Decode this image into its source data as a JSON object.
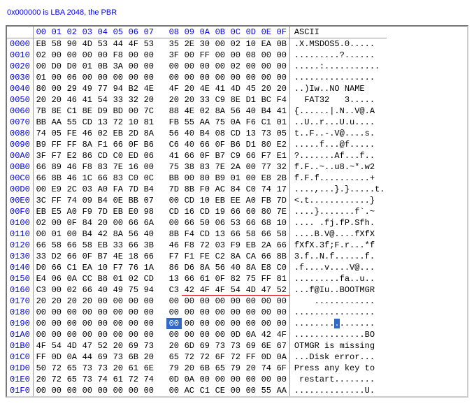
{
  "note": "0x000000 is LBA 2048, the PBR",
  "headers": {
    "offset": "",
    "cols": [
      "00",
      "01",
      "02",
      "03",
      "04",
      "05",
      "06",
      "07",
      "08",
      "09",
      "0A",
      "0B",
      "0C",
      "0D",
      "0E",
      "0F"
    ],
    "ascii": "ASCII"
  },
  "highlight": {
    "row": 25,
    "col": 8
  },
  "underline": {
    "row": 22,
    "start": 9,
    "end": 15
  },
  "rows": [
    {
      "off": "0000",
      "hex": [
        "EB",
        "58",
        "90",
        "4D",
        "53",
        "44",
        "4F",
        "53",
        "35",
        "2E",
        "30",
        "00",
        "02",
        "10",
        "EA",
        "0B"
      ],
      "asc": ".X.MSDOS5.0....."
    },
    {
      "off": "0010",
      "hex": [
        "02",
        "00",
        "00",
        "00",
        "00",
        "F8",
        "00",
        "00",
        "3F",
        "00",
        "FF",
        "00",
        "00",
        "08",
        "00",
        "00"
      ],
      "asc": ".........?......"
    },
    {
      "off": "0020",
      "hex": [
        "00",
        "D0",
        "D0",
        "01",
        "0B",
        "3A",
        "00",
        "00",
        "00",
        "00",
        "00",
        "00",
        "02",
        "00",
        "00",
        "00"
      ],
      "asc": ".....:..........."
    },
    {
      "off": "0030",
      "hex": [
        "01",
        "00",
        "06",
        "00",
        "00",
        "00",
        "00",
        "00",
        "00",
        "00",
        "00",
        "00",
        "00",
        "00",
        "00",
        "00"
      ],
      "asc": "................"
    },
    {
      "off": "0040",
      "hex": [
        "80",
        "00",
        "29",
        "49",
        "77",
        "94",
        "B2",
        "4E",
        "4F",
        "20",
        "4E",
        "41",
        "4D",
        "45",
        "20",
        "20"
      ],
      "asc": "..)Iw..NO NAME  "
    },
    {
      "off": "0050",
      "hex": [
        "20",
        "20",
        "46",
        "41",
        "54",
        "33",
        "32",
        "20",
        "20",
        "20",
        "33",
        "C9",
        "8E",
        "D1",
        "BC",
        "F4"
      ],
      "asc": "  FAT32   3....."
    },
    {
      "off": "0060",
      "hex": [
        "7B",
        "8E",
        "C1",
        "8E",
        "D9",
        "BD",
        "00",
        "7C",
        "88",
        "4E",
        "02",
        "8A",
        "56",
        "40",
        "B4",
        "41"
      ],
      "asc": "{......|.N..V@.A"
    },
    {
      "off": "0070",
      "hex": [
        "BB",
        "AA",
        "55",
        "CD",
        "13",
        "72",
        "10",
        "81",
        "FB",
        "55",
        "AA",
        "75",
        "0A",
        "F6",
        "C1",
        "01"
      ],
      "asc": "..U..r...U.u...."
    },
    {
      "off": "0080",
      "hex": [
        "74",
        "05",
        "FE",
        "46",
        "02",
        "EB",
        "2D",
        "8A",
        "56",
        "40",
        "B4",
        "08",
        "CD",
        "13",
        "73",
        "05"
      ],
      "asc": "t..F..-.V@....s."
    },
    {
      "off": "0090",
      "hex": [
        "B9",
        "FF",
        "FF",
        "8A",
        "F1",
        "66",
        "0F",
        "B6",
        "C6",
        "40",
        "66",
        "0F",
        "B6",
        "D1",
        "80",
        "E2"
      ],
      "asc": ".....f...@f....."
    },
    {
      "off": "00A0",
      "hex": [
        "3F",
        "F7",
        "E2",
        "86",
        "CD",
        "C0",
        "ED",
        "06",
        "41",
        "66",
        "0F",
        "B7",
        "C9",
        "66",
        "F7",
        "E1"
      ],
      "asc": "?.......Af...f.."
    },
    {
      "off": "00B0",
      "hex": [
        "66",
        "89",
        "46",
        "F8",
        "83",
        "7E",
        "16",
        "00",
        "75",
        "38",
        "83",
        "7E",
        "2A",
        "00",
        "77",
        "32"
      ],
      "asc": "f.F..~..u8.~*.w2"
    },
    {
      "off": "00C0",
      "hex": [
        "66",
        "8B",
        "46",
        "1C",
        "66",
        "83",
        "C0",
        "0C",
        "BB",
        "00",
        "80",
        "B9",
        "01",
        "00",
        "E8",
        "2B"
      ],
      "asc": "f.F.f..........+"
    },
    {
      "off": "00D0",
      "hex": [
        "00",
        "E9",
        "2C",
        "03",
        "A0",
        "FA",
        "7D",
        "B4",
        "7D",
        "8B",
        "F0",
        "AC",
        "84",
        "C0",
        "74",
        "17"
      ],
      "asc": "....,...}.}.....t."
    },
    {
      "off": "00E0",
      "hex": [
        "3C",
        "FF",
        "74",
        "09",
        "B4",
        "0E",
        "BB",
        "07",
        "00",
        "CD",
        "10",
        "EB",
        "EE",
        "A0",
        "FB",
        "7D"
      ],
      "asc": "<.t............}"
    },
    {
      "off": "00F0",
      "hex": [
        "EB",
        "E5",
        "A0",
        "F9",
        "7D",
        "EB",
        "E0",
        "98",
        "CD",
        "16",
        "CD",
        "19",
        "66",
        "60",
        "80",
        "7E"
      ],
      "asc": "....}.......f`.~"
    },
    {
      "off": "0100",
      "hex": [
        "02",
        "00",
        "0F",
        "84",
        "20",
        "00",
        "66",
        "6A",
        "00",
        "66",
        "50",
        "06",
        "53",
        "66",
        "68",
        "10"
      ],
      "asc": ".... .fj.fP.Sfh."
    },
    {
      "off": "0110",
      "hex": [
        "00",
        "01",
        "00",
        "B4",
        "42",
        "8A",
        "56",
        "40",
        "8B",
        "F4",
        "CD",
        "13",
        "66",
        "58",
        "66",
        "58"
      ],
      "asc": "....B.V@....fXfX"
    },
    {
      "off": "0120",
      "hex": [
        "66",
        "58",
        "66",
        "58",
        "EB",
        "33",
        "66",
        "3B",
        "46",
        "F8",
        "72",
        "03",
        "F9",
        "EB",
        "2A",
        "66"
      ],
      "asc": "fXfX.3f;F.r...*f"
    },
    {
      "off": "0130",
      "hex": [
        "33",
        "D2",
        "66",
        "0F",
        "B7",
        "4E",
        "18",
        "66",
        "F7",
        "F1",
        "FE",
        "C2",
        "8A",
        "CA",
        "66",
        "8B"
      ],
      "asc": "3.f..N.f......f."
    },
    {
      "off": "0140",
      "hex": [
        "D0",
        "66",
        "C1",
        "EA",
        "10",
        "F7",
        "76",
        "1A",
        "86",
        "D6",
        "8A",
        "56",
        "40",
        "8A",
        "E8",
        "C0"
      ],
      "asc": ".f....v....V@..."
    },
    {
      "off": "0150",
      "hex": [
        "E4",
        "06",
        "0A",
        "CC",
        "B8",
        "01",
        "02",
        "CD",
        "13",
        "66",
        "61",
        "0F",
        "82",
        "75",
        "FF",
        "81"
      ],
      "asc": ".........fa..u.."
    },
    {
      "off": "0160",
      "hex": [
        "C3",
        "00",
        "02",
        "66",
        "40",
        "49",
        "75",
        "94",
        "C3",
        "42",
        "4F",
        "4F",
        "54",
        "4D",
        "47",
        "52"
      ],
      "asc": "...f@Iu..BOOTMGR"
    },
    {
      "off": "0170",
      "hex": [
        "20",
        "20",
        "20",
        "20",
        "00",
        "00",
        "00",
        "00",
        "00",
        "00",
        "00",
        "00",
        "00",
        "00",
        "00",
        "00"
      ],
      "asc": "    ............"
    },
    {
      "off": "0180",
      "hex": [
        "00",
        "00",
        "00",
        "00",
        "00",
        "00",
        "00",
        "00",
        "00",
        "00",
        "00",
        "00",
        "00",
        "00",
        "00",
        "00"
      ],
      "asc": "................"
    },
    {
      "off": "0190",
      "hex": [
        "00",
        "00",
        "00",
        "00",
        "00",
        "00",
        "00",
        "00",
        "00",
        "00",
        "00",
        "00",
        "00",
        "00",
        "00",
        "00"
      ],
      "asc": "................"
    },
    {
      "off": "01A0",
      "hex": [
        "00",
        "00",
        "00",
        "00",
        "00",
        "00",
        "00",
        "00",
        "00",
        "00",
        "00",
        "00",
        "0D",
        "0A",
        "42",
        "4F"
      ],
      "asc": "..............BO"
    },
    {
      "off": "01B0",
      "hex": [
        "4F",
        "54",
        "4D",
        "47",
        "52",
        "20",
        "69",
        "73",
        "20",
        "6D",
        "69",
        "73",
        "73",
        "69",
        "6E",
        "67"
      ],
      "asc": "OTMGR is missing"
    },
    {
      "off": "01C0",
      "hex": [
        "FF",
        "0D",
        "0A",
        "44",
        "69",
        "73",
        "6B",
        "20",
        "65",
        "72",
        "72",
        "6F",
        "72",
        "FF",
        "0D",
        "0A"
      ],
      "asc": "...Disk error..."
    },
    {
      "off": "01D0",
      "hex": [
        "50",
        "72",
        "65",
        "73",
        "73",
        "20",
        "61",
        "6E",
        "79",
        "20",
        "6B",
        "65",
        "79",
        "20",
        "74",
        "6F"
      ],
      "asc": "Press any key to"
    },
    {
      "off": "01E0",
      "hex": [
        "20",
        "72",
        "65",
        "73",
        "74",
        "61",
        "72",
        "74",
        "0D",
        "0A",
        "00",
        "00",
        "00",
        "00",
        "00",
        "00"
      ],
      "asc": " restart........"
    },
    {
      "off": "01F0",
      "hex": [
        "00",
        "00",
        "00",
        "00",
        "00",
        "00",
        "00",
        "00",
        "00",
        "AC",
        "C1",
        "CE",
        "00",
        "00",
        "55",
        "AA"
      ],
      "asc": "..............U."
    }
  ]
}
